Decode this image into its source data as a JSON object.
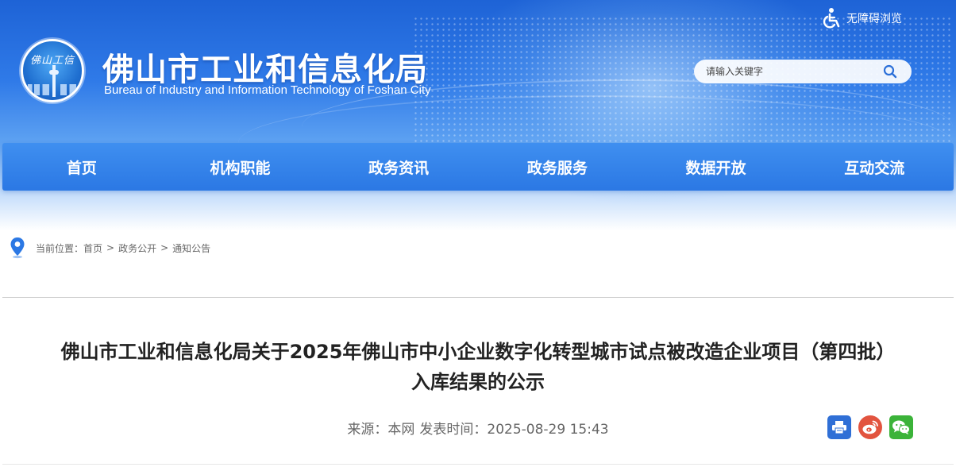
{
  "header": {
    "logo_text": "佛山工信",
    "site_title": "佛山市工业和信息化局",
    "site_subtitle": "Bureau of Industry and Information Technology of Foshan City",
    "accessibility_label": "无障碍浏览",
    "search": {
      "placeholder": "请输入关键字",
      "value": ""
    }
  },
  "nav": {
    "items": [
      {
        "label": "首页"
      },
      {
        "label": "机构职能"
      },
      {
        "label": "政务资讯"
      },
      {
        "label": "政务服务"
      },
      {
        "label": "数据开放"
      },
      {
        "label": "互动交流"
      }
    ]
  },
  "breadcrumb": {
    "prefix": "当前位置：",
    "items": [
      {
        "label": "首页"
      },
      {
        "label": "政务公开"
      },
      {
        "label": "通知公告"
      }
    ],
    "separator": ">"
  },
  "article": {
    "title_line1": "佛山市工业和信息化局关于2025年佛山市中小企业数字化转型城市试点被改造企业项目（第四批）",
    "title_line2": "入库结果的公示",
    "source": "来源：本网",
    "published": "发表时间：2025-08-29 15:43"
  },
  "share": {
    "icons": [
      "print-icon",
      "weibo-icon",
      "wechat-icon"
    ]
  },
  "colors": {
    "banner_blue": "#2f7ae8",
    "nav_blue": "#3f8ff0",
    "print": "#2f6fd6",
    "weibo": "#e2543f",
    "wechat": "#3bb339"
  }
}
